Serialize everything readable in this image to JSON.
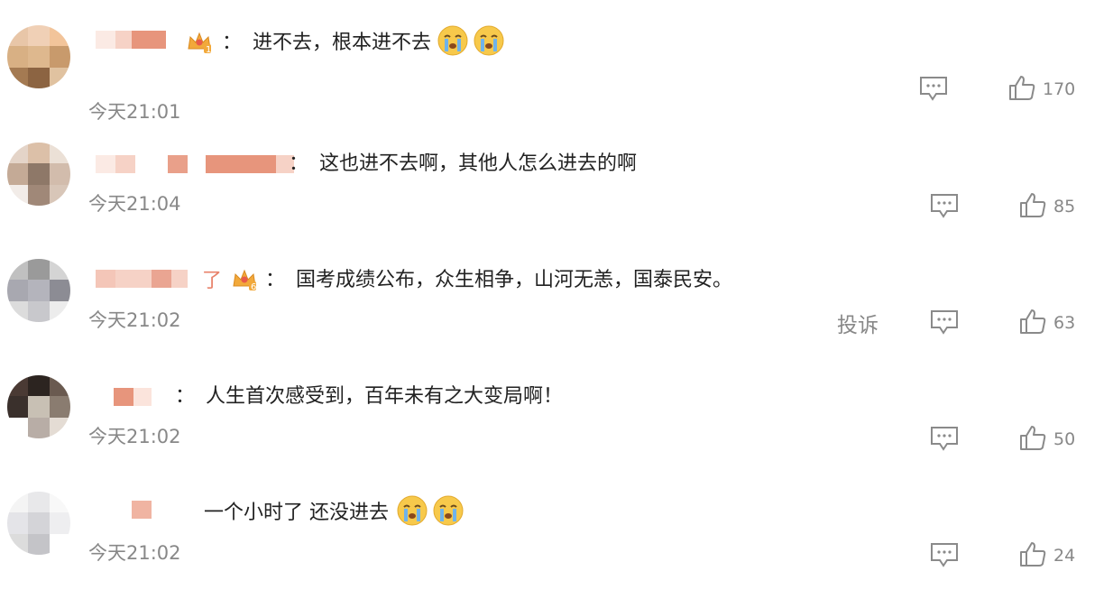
{
  "comments": [
    {
      "text": "进不去，根本进不去",
      "emoji_count": 2,
      "has_crown": true,
      "crown_level": "1",
      "time": "今天21:01",
      "reply_icon": "comment-icon",
      "like_icon": "thumbs-up-icon",
      "likes": "170",
      "report_label": ""
    },
    {
      "text": "这也进不去啊，其他人怎么进去的啊",
      "emoji_count": 0,
      "has_crown": false,
      "crown_level": "",
      "time": "今天21:04",
      "reply_icon": "comment-icon",
      "like_icon": "thumbs-up-icon",
      "likes": "85",
      "report_label": ""
    },
    {
      "name_visible_char": "了",
      "text": "国考成绩公布，众生相争，山河无恙，国泰民安。",
      "emoji_count": 0,
      "has_crown": true,
      "crown_level": "6",
      "time": "今天21:02",
      "reply_icon": "comment-icon",
      "like_icon": "thumbs-up-icon",
      "likes": "63",
      "report_label": "投诉"
    },
    {
      "text": "人生首次感受到，百年未有之大变局啊！",
      "emoji_count": 0,
      "has_crown": false,
      "crown_level": "",
      "time": "今天21:02",
      "reply_icon": "comment-icon",
      "like_icon": "thumbs-up-icon",
      "likes": "50",
      "report_label": ""
    },
    {
      "text": "一个小时了 还没进去",
      "emoji_count": 2,
      "has_crown": false,
      "crown_level": "",
      "time": "今天21:02",
      "reply_icon": "comment-icon",
      "like_icon": "thumbs-up-icon",
      "likes": "24",
      "report_label": ""
    }
  ],
  "colors": {
    "text": "#222222",
    "meta": "#888888",
    "name_accent": "#e88a6e",
    "emoji_face": "#f7c94b",
    "emoji_tear": "#6fb3ea"
  }
}
